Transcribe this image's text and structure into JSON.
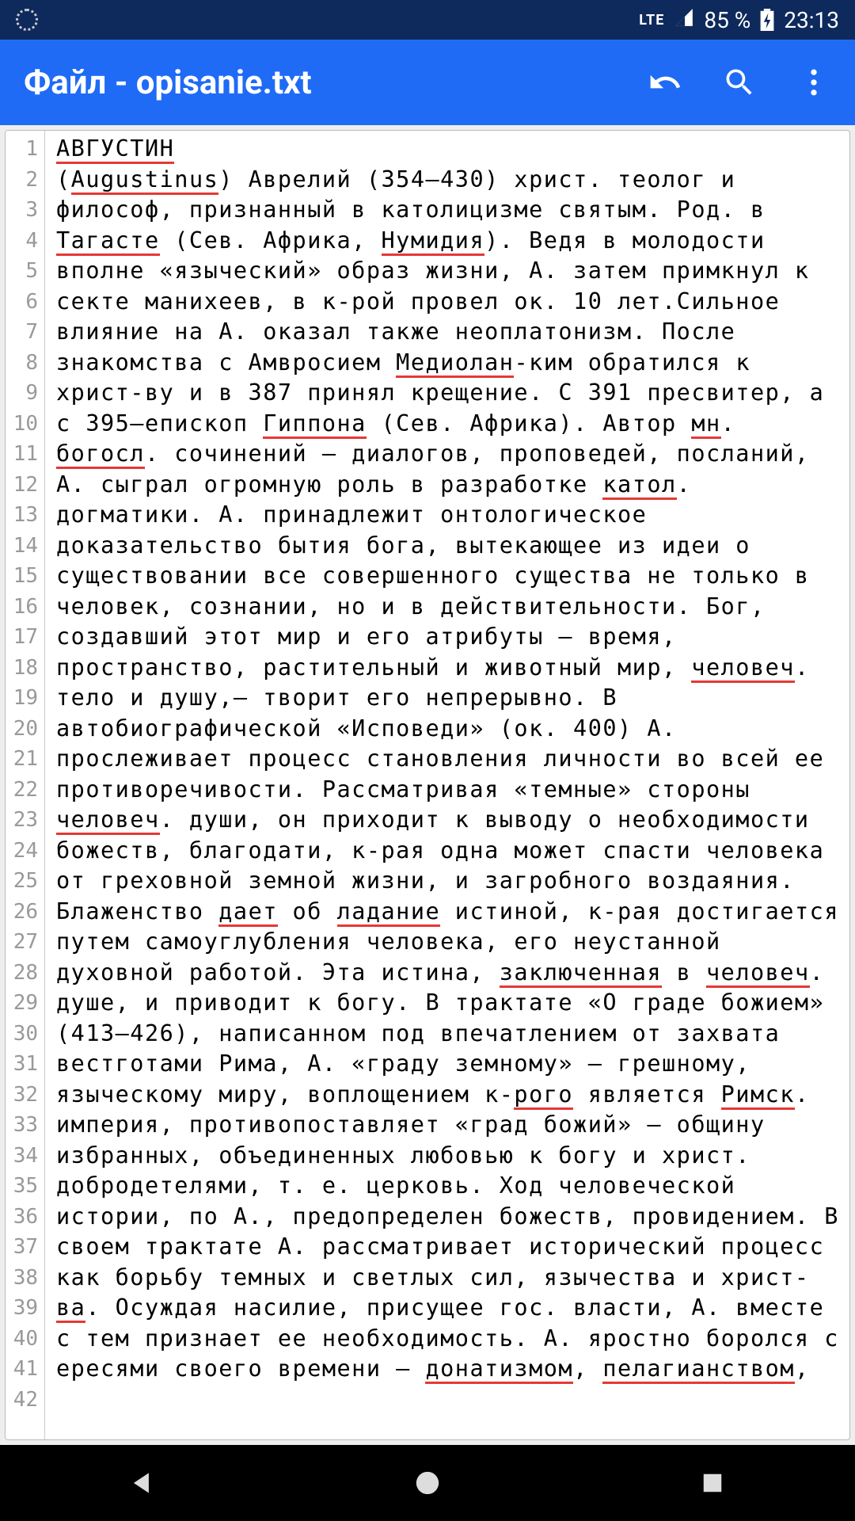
{
  "status": {
    "network": "LTE",
    "battery_pct": "85 %",
    "time": "23:13"
  },
  "appbar": {
    "title": "Файл - opisanie.txt"
  },
  "editor": {
    "line_count": 42,
    "segments": [
      {
        "t": "АВГУСТИН",
        "u": true
      },
      {
        "t": "\n("
      },
      {
        "t": "Augustinus",
        "u": true
      },
      {
        "t": ") Аврелий (354—430) христ. теолог и философ, признанный в католицизме святым. Род. в "
      },
      {
        "t": "Тагасте",
        "u": true
      },
      {
        "t": " (Сев. Африка, "
      },
      {
        "t": "Нумидия",
        "u": true
      },
      {
        "t": "). Ведя в молодости вполне «языческий» образ жизни, А. затем примкнул к секте манихеев, в к-рой провел ок. 10 лет.Сильное влияние на А. оказал также неоплатонизм. После знакомства с Амвросием "
      },
      {
        "t": "Медиолан",
        "u": true
      },
      {
        "t": "-ким обратился к христ-ву и в 387 принял крещение. С 391 пресвитер, а с 395—епископ "
      },
      {
        "t": "Гиппона",
        "u": true
      },
      {
        "t": " (Сев. Африка). Автор "
      },
      {
        "t": "мн",
        "u": true
      },
      {
        "t": ". "
      },
      {
        "t": "богосл",
        "u": true
      },
      {
        "t": ". сочинений — диалогов, проповедей, посланий, А. сыграл огромную роль в разработке "
      },
      {
        "t": "катол",
        "u": true
      },
      {
        "t": ". догматики. А. принадлежит онтологическое доказательство бытия бога, вытекающее из идеи о существовании все совершенного существа не только в человек, сознании, но и в действительности. Бог, создавший этот мир и его атрибуты — время, пространство, растительный и животный мир, "
      },
      {
        "t": "человеч",
        "u": true
      },
      {
        "t": ". тело и душу,— творит его непрерывно. В автобиографической «Исповеди» (ок. 400) А. прослеживает процесс становления личности во всей ее противоречивости. Рассматривая «темные» стороны "
      },
      {
        "t": "человеч",
        "u": true
      },
      {
        "t": ". души, он приходит к выводу о необходимости божеств, благодати, к-рая одна может спасти человека от греховной земной жизни, и загробного воздаяния. Блаженство "
      },
      {
        "t": "дает",
        "u": true
      },
      {
        "t": " об "
      },
      {
        "t": "ладание",
        "u": true
      },
      {
        "t": " истиной, к-рая достигается путем самоуглубления человека, его неустанной духовной работой. Эта истина, "
      },
      {
        "t": "заключенная",
        "u": true
      },
      {
        "t": " в "
      },
      {
        "t": "человеч",
        "u": true
      },
      {
        "t": ". душе, и приводит к богу. В трактате «О граде божием» (413—426), написанном под впечатлением от захвата вестготами Рима, А. «граду земному» — грешному, языческому миру, воплощением к-"
      },
      {
        "t": "рого",
        "u": true
      },
      {
        "t": " является "
      },
      {
        "t": "Римск",
        "u": true
      },
      {
        "t": ". империя, противопоставляет «град божий» — общину избранных, объединенных любовью к богу и христ. добродетелями, т. е. церковь. Ход человеческой истории, по А., предопределен божеств, провидением. В своем трактате А. рассматривает исторический процесс как борьбу темных и светлых сил, язычества и христ-"
      },
      {
        "t": "ва",
        "u": true
      },
      {
        "t": ". Осуждая насилие, присущее гос. власти, А. вместе с тем признает ее необходимость. А. яростно боролся с ересями своего времени — "
      },
      {
        "t": "донатизмом",
        "u": true
      },
      {
        "t": ", "
      },
      {
        "t": "пелагианством",
        "u": true
      },
      {
        "t": ","
      }
    ]
  }
}
